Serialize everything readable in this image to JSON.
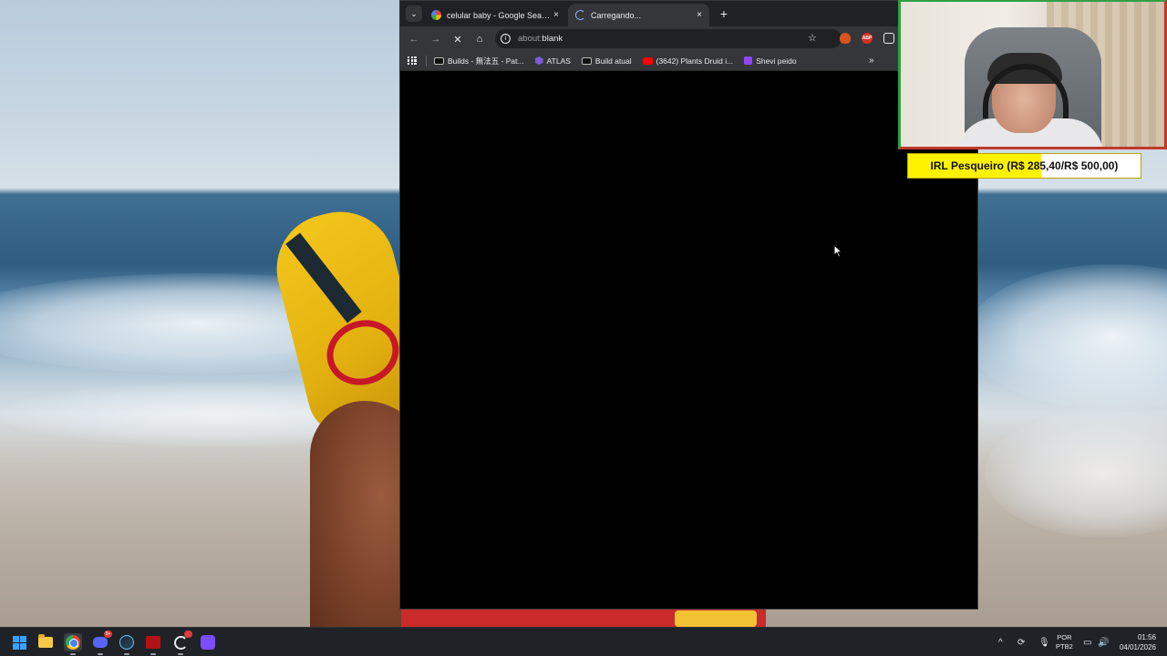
{
  "browser": {
    "tabs": [
      {
        "title": "celular baby - Google Search",
        "close": "×",
        "loading": false
      },
      {
        "title": "Carregando...",
        "close": "×",
        "loading": true
      }
    ],
    "tab_search_icon": "⌄",
    "new_tab_label": "+",
    "toolbar": {
      "back": "←",
      "forward": "→",
      "stop": "✕",
      "home": "⌂",
      "url_scheme": "about:",
      "url_rest": "blank",
      "star": "☆",
      "ext_abp": "ABP"
    },
    "bookmarks": [
      {
        "label": "Builds - 無法五 - Pat...",
        "icon": "poe-icon"
      },
      {
        "label": "ATLAS",
        "icon": "atlas-icon"
      },
      {
        "label": "Build atual",
        "icon": "poe-icon"
      },
      {
        "label": "(3642) Plants Druid i...",
        "icon": "youtube-icon"
      },
      {
        "label": "Shevi peido",
        "icon": "twitch-icon"
      }
    ],
    "bookmarks_more": "»"
  },
  "overlay": {
    "goal_text": "IRL Pesqueiro (R$ 285,40/R$ 500,00)",
    "goal_progress": 0.5708,
    "goal_fill_color": "#fff200"
  },
  "taskbar": {
    "discord_badge": "9+",
    "steam_badge": "",
    "tray": {
      "chevron": "^",
      "lang_line1": "POR",
      "lang_line2": "PTB2",
      "time": "01:56",
      "date": "04/01/2026"
    }
  }
}
